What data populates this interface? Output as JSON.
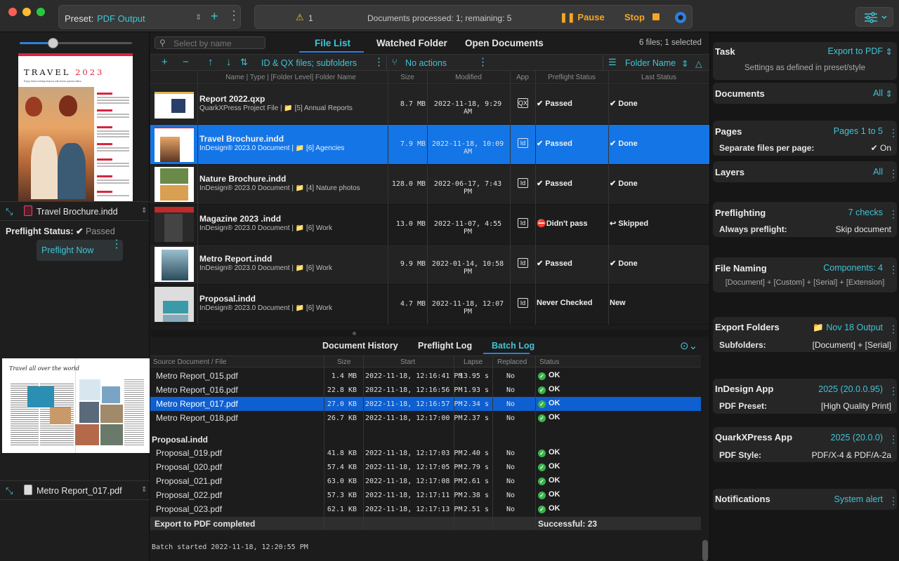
{
  "preset": {
    "label": "Preset:",
    "value": "PDF Output"
  },
  "status": {
    "warning_count": "1",
    "message": "Documents processed: 1; remaining: 5",
    "pause": "Pause",
    "stop": "Stop"
  },
  "left": {
    "preview1": {
      "title": "TRAVEL",
      "year": "2023",
      "tagline": "Enjoy these holiday lessons with these special offers."
    },
    "file1": "Travel Brochure.indd",
    "preflight_status_label": "Preflight Status:",
    "preflight_status_value": "Passed",
    "preflight_now": "Preflight Now",
    "preview2": {
      "heading": "Travel all over the world"
    },
    "file2": "Metro Report_017.pdf"
  },
  "center": {
    "search_placeholder": "Select by name",
    "tabs": [
      "File List",
      "Watched Folder",
      "Open Documents"
    ],
    "count": "6 files; 1 selected",
    "toolbar": {
      "filter": "ID & QX files; subfolders",
      "actions": "No actions",
      "sort": "Folder Name"
    },
    "columns": [
      "Name | Type | [Folder Level] Folder Name",
      "Size",
      "Modified",
      "App",
      "Preflight Status",
      "Last Status"
    ],
    "files": [
      {
        "name": "Report 2022.qxp",
        "sub": "QuarkXPress Project File | 📁 [5] Annual Reports",
        "size": "8.7 MB",
        "modified": "2022-11-18, 9:29 AM",
        "app": "QX",
        "preflight": "✔ Passed",
        "last": "✔ Done"
      },
      {
        "name": "Travel Brochure.indd",
        "sub": "InDesign® 2023.0 Document | 📁 [6] Agencies",
        "size": "7.9 MB",
        "modified": "2022-11-18, 10:09 AM",
        "app": "Id",
        "preflight": "✔ Passed",
        "last": "✔ Done"
      },
      {
        "name": "Nature Brochure.indd",
        "sub": "InDesign® 2023.0 Document | 📁 [4] Nature photos",
        "size": "128.0 MB",
        "modified": "2022-06-17, 7:43 PM",
        "app": "Id",
        "preflight": "✔ Passed",
        "last": "✔ Done"
      },
      {
        "name": "Magazine 2023 .indd",
        "sub": "InDesign® 2023.0 Document | 📁 [6] Work",
        "size": "13.0 MB",
        "modified": "2022-11-07, 4:55 PM",
        "app": "Id",
        "preflight": "⛔Didn't pass",
        "last": "↩ Skipped"
      },
      {
        "name": "Metro Report.indd",
        "sub": "InDesign® 2023.0 Document | 📁 [6] Work",
        "size": "9.9 MB",
        "modified": "2022-01-14, 10:58 PM",
        "app": "Id",
        "preflight": "✔ Passed",
        "last": "✔ Done"
      },
      {
        "name": "Proposal.indd",
        "sub": "InDesign® 2023.0 Document | 📁 [6] Work",
        "size": "4.7 MB",
        "modified": "2022-11-18, 12:07 PM",
        "app": "Id",
        "preflight": "Never Checked",
        "last": "New"
      }
    ],
    "bottom_tabs": [
      "Document History",
      "Preflight Log",
      "Batch Log"
    ],
    "log_columns": [
      "Source Document / File",
      "Size",
      "Start",
      "Lapse",
      "Replaced",
      "Status"
    ],
    "log_rows_a": [
      {
        "src": "Metro Report_015.pdf",
        "size": "1.4 MB",
        "start": "2022-11-18, 12:16:41 PM",
        "lapse": "13.95 s",
        "replaced": "No",
        "status": "OK"
      },
      {
        "src": "Metro Report_016.pdf",
        "size": "22.8 KB",
        "start": "2022-11-18, 12:16:56 PM",
        "lapse": "1.93 s",
        "replaced": "No",
        "status": "OK"
      },
      {
        "src": "Metro Report_017.pdf",
        "size": "27.0 KB",
        "start": "2022-11-18, 12:16:57 PM",
        "lapse": "2.34 s",
        "replaced": "No",
        "status": "OK"
      },
      {
        "src": "Metro Report_018.pdf",
        "size": "26.7 KB",
        "start": "2022-11-18, 12:17:00 PM",
        "lapse": "2.37 s",
        "replaced": "No",
        "status": "OK"
      }
    ],
    "group": "Proposal.indd",
    "log_rows_b": [
      {
        "src": "Proposal_019.pdf",
        "size": "41.8 KB",
        "start": "2022-11-18, 12:17:03 PM",
        "lapse": "2.40 s",
        "replaced": "No",
        "status": "OK"
      },
      {
        "src": "Proposal_020.pdf",
        "size": "57.4 KB",
        "start": "2022-11-18, 12:17:05 PM",
        "lapse": "2.79 s",
        "replaced": "No",
        "status": "OK"
      },
      {
        "src": "Proposal_021.pdf",
        "size": "63.0 KB",
        "start": "2022-11-18, 12:17:08 PM",
        "lapse": "2.61 s",
        "replaced": "No",
        "status": "OK"
      },
      {
        "src": "Proposal_022.pdf",
        "size": "57.3 KB",
        "start": "2022-11-18, 12:17:11 PM",
        "lapse": "2.38 s",
        "replaced": "No",
        "status": "OK"
      },
      {
        "src": "Proposal_023.pdf",
        "size": "62.1 KB",
        "start": "2022-11-18, 12:17:13 PM",
        "lapse": "2.51 s",
        "replaced": "No",
        "status": "OK"
      }
    ],
    "summary_left": "Export to PDF completed",
    "summary_right": "Successful: 23",
    "batch_started": "Batch started 2022-11-18, 12:20:55 PM"
  },
  "right": {
    "task": {
      "title": "Task",
      "value": "Export to PDF",
      "sub": "Settings as defined in preset/style"
    },
    "documents": {
      "title": "Documents",
      "value": "All"
    },
    "pages": {
      "title": "Pages",
      "value": "Pages 1 to 5",
      "k": "Separate files per page:",
      "v": "✔ On"
    },
    "layers": {
      "title": "Layers",
      "value": "All"
    },
    "preflighting": {
      "title": "Preflighting",
      "value": "7 checks",
      "k": "Always preflight:",
      "v": "Skip document"
    },
    "naming": {
      "title": "File Naming",
      "value": "Components: 4",
      "sub": "[Document] + [Custom] + [Serial] + [Extension]"
    },
    "folders": {
      "title": "Export Folders",
      "value": "📁 Nov 18 Output",
      "k": "Subfolders:",
      "v": "[Document] + [Serial]"
    },
    "indesign": {
      "title": "InDesign App",
      "value": "2025 (20.0.0.95)",
      "k": "PDF Preset:",
      "v": "[High Quality Print]"
    },
    "quark": {
      "title": "QuarkXPress App",
      "value": "2025 (20.0.0)",
      "k": "PDF Style:",
      "v": "PDF/X-4 & PDF/A-2a"
    },
    "notifications": {
      "title": "Notifications",
      "value": "System alert"
    }
  },
  "colors": {
    "accent": "#40c4d6",
    "selection": "#1475e6",
    "warning": "#f5a623",
    "ok": "#38b44a"
  }
}
